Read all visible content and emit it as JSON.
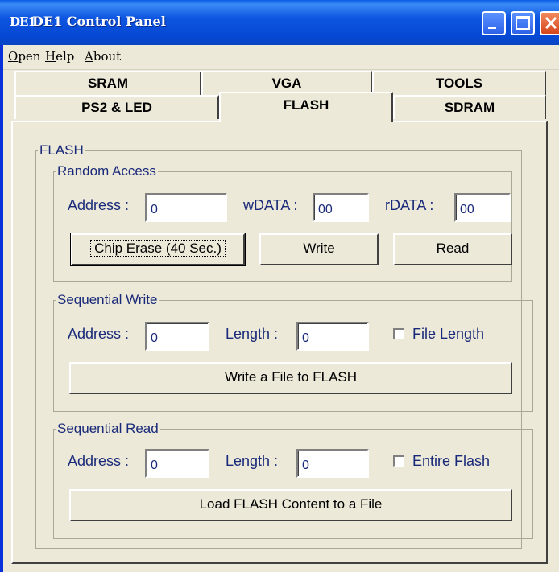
{
  "window": {
    "logo": "DE1",
    "title": "DE1 Control Panel"
  },
  "menu": [
    "Open",
    "Help",
    "About"
  ],
  "tabs": {
    "row1": [
      "SRAM",
      "VGA",
      "TOOLS"
    ],
    "row2": [
      "PS2 & LED",
      "FLASH",
      "SDRAM"
    ],
    "active": "FLASH"
  },
  "flash": {
    "group_title": "FLASH",
    "random_access": {
      "title": "Random Access",
      "address_label": "Address :",
      "address_value": "0",
      "wdata_label": "wDATA :",
      "wdata_value": "00",
      "rdata_label": "rDATA :",
      "rdata_value": "00",
      "chip_erase_label": "Chip Erase (40 Sec.)",
      "write_label": "Write",
      "read_label": "Read"
    },
    "sequential_write": {
      "title": "Sequential Write",
      "address_label": "Address :",
      "address_value": "0",
      "length_label": "Length :",
      "length_value": "0",
      "file_length_label": "File Length",
      "button_label": "Write a File to FLASH"
    },
    "sequential_read": {
      "title": "Sequential Read",
      "address_label": "Address :",
      "address_value": "0",
      "length_label": "Length :",
      "length_value": "0",
      "entire_flash_label": "Entire Flash",
      "button_label": "Load FLASH Content to a File"
    }
  }
}
